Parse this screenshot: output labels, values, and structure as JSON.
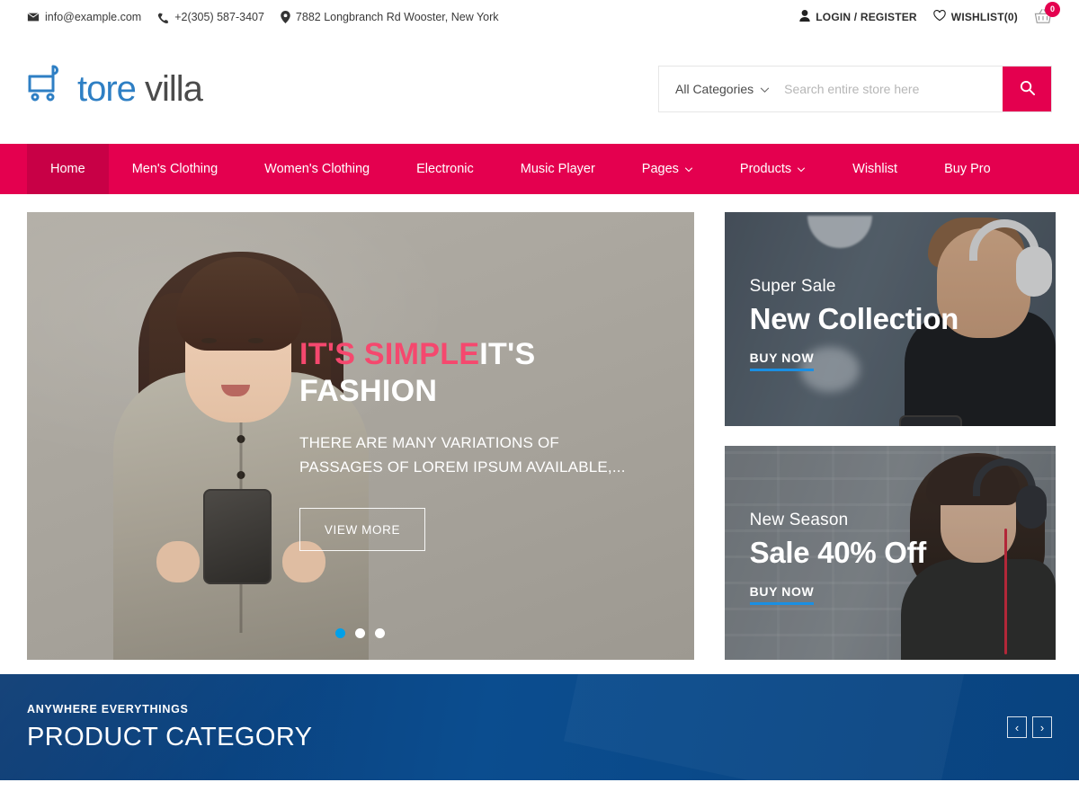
{
  "topbar": {
    "email": "info@example.com",
    "phone": "+2(305) 587-3407",
    "address": "7882 Longbranch Rd Wooster, New York",
    "login": "LOGIN / REGISTER",
    "wishlist": "WISHLIST(0)",
    "cart_count": "0",
    "icons": {
      "email": "envelope-icon",
      "phone": "phone-icon",
      "address": "map-pin-icon",
      "login": "user-icon",
      "wishlist": "heart-icon",
      "cart": "basket-icon"
    }
  },
  "header": {
    "logo_primary": "tore",
    "logo_secondary": "villa",
    "logo_full": "Store villa",
    "search": {
      "category_label": "All Categories",
      "placeholder": "Search entire store here",
      "value": "",
      "button_icon": "search-icon"
    }
  },
  "nav": {
    "items": [
      {
        "label": "Home",
        "active": true,
        "has_dropdown": false
      },
      {
        "label": "Men's Clothing",
        "active": false,
        "has_dropdown": false
      },
      {
        "label": "Women's Clothing",
        "active": false,
        "has_dropdown": false
      },
      {
        "label": "Electronic",
        "active": false,
        "has_dropdown": false
      },
      {
        "label": "Music Player",
        "active": false,
        "has_dropdown": false
      },
      {
        "label": "Pages",
        "active": false,
        "has_dropdown": true
      },
      {
        "label": "Products",
        "active": false,
        "has_dropdown": true
      },
      {
        "label": "Wishlist",
        "active": false,
        "has_dropdown": false
      },
      {
        "label": "Buy Pro",
        "active": false,
        "has_dropdown": false
      }
    ]
  },
  "hero": {
    "title_accent": "IT'S SIMPLE",
    "title_rest": "IT'S FASHION",
    "subtitle": "THERE ARE MANY VARIATIONS OF PASSAGES OF LOREM IPSUM AVAILABLE,...",
    "button": "VIEW MORE",
    "slides": 3,
    "active_slide": 1
  },
  "promos": [
    {
      "kicker": "Super Sale",
      "title": "New Collection",
      "cta": "BUY NOW"
    },
    {
      "kicker": "New Season",
      "title": "Sale 40% Off",
      "cta": "BUY NOW"
    }
  ],
  "category_section": {
    "kicker": "ANYWHERE EVERYTHINGS",
    "title": "PRODUCT CATEGORY",
    "prev": "‹",
    "next": "›"
  },
  "colors": {
    "accent": "#e4004f",
    "accent_dark": "#c80046",
    "logo_blue": "#2e7fc4",
    "cta_blue": "#1a8fe3",
    "dot_active": "#00a0e9",
    "section_blue": "#0b4d8f",
    "hero_pink": "#f5486e"
  }
}
